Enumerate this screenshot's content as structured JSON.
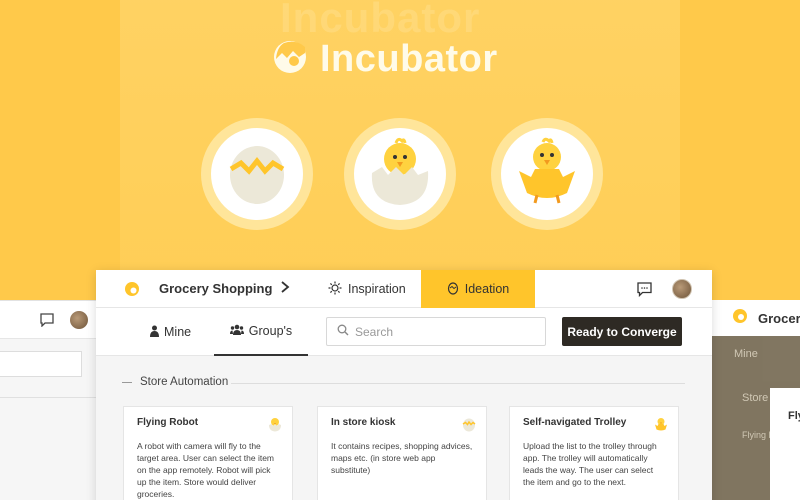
{
  "hero": {
    "brand": "Incubator",
    "ghost_title": "Incubator",
    "stages": [
      {
        "name": "egg-cracking"
      },
      {
        "name": "chick-hatching"
      },
      {
        "name": "chick-hatched"
      }
    ]
  },
  "topbar": {
    "project_title": "Grocery Shopping",
    "tabs": [
      {
        "label": "Inspiration",
        "icon": "sun-icon",
        "active": false
      },
      {
        "label": "Ideation",
        "icon": "egg-icon",
        "active": true
      }
    ]
  },
  "subbar": {
    "tabs": [
      {
        "label": "Mine",
        "icon": "person-icon",
        "active": false
      },
      {
        "label": "Group's",
        "icon": "group-icon",
        "active": true
      }
    ],
    "search_placeholder": "Search",
    "converge_label": "Ready to Converge"
  },
  "section": {
    "label": "Store Automation"
  },
  "cards": [
    {
      "title": "Flying Robot",
      "description": "A robot with camera will fly to the target area. User can select the item on the app remotely. Robot will pick up the item. Store would deliver groceries."
    },
    {
      "title": "In store kiosk",
      "description": "It contains recipes, shopping advices, maps etc. (in store web app substitute)"
    },
    {
      "title": "Self-navigated Trolley",
      "description": "Upload the list to the trolley through app. The trolley will automatically leads the way. The user can select the item and go to the next."
    }
  ],
  "ghost_right": {
    "title": "Grocery",
    "mine": "Mine",
    "section": "Store",
    "card_title": "Flying R",
    "card_title2": "Fly"
  },
  "colors": {
    "accent": "#ffc52b",
    "hero_bg": "#ffc94a",
    "button_dark": "#2e2a24"
  }
}
